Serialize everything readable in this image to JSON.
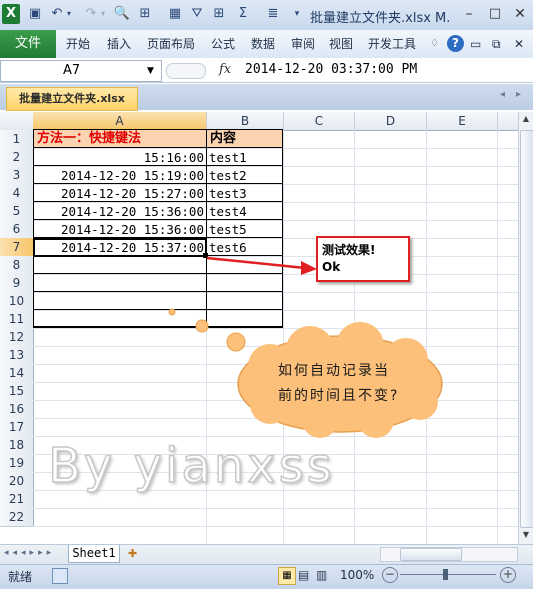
{
  "window": {
    "title": "批量建立文件夹.xlsx M."
  },
  "ribbon": {
    "file": "文件",
    "tabs": [
      "开始",
      "插入",
      "页面布局",
      "公式",
      "数据",
      "审阅",
      "视图",
      "开发工具"
    ]
  },
  "formula_bar": {
    "name_box": "A7",
    "fx": "fx",
    "value": "2014-12-20  03:37:00 PM"
  },
  "document_tab": "批量建立文件夹.xlsx",
  "columns": [
    "A",
    "B",
    "C",
    "D",
    "E"
  ],
  "rows": [
    "1",
    "2",
    "3",
    "4",
    "5",
    "6",
    "7",
    "8",
    "9",
    "10",
    "11",
    "12",
    "13",
    "14",
    "15",
    "16",
    "17",
    "18",
    "19",
    "20",
    "21",
    "22"
  ],
  "table": {
    "header_a": "方法一：快捷键法",
    "header_b": "内容",
    "a": [
      "15:16:00",
      "2014-12-20 15:19:00",
      "2014-12-20 15:27:00",
      "2014-12-20 15:36:00",
      "2014-12-20 15:36:00",
      "2014-12-20 15:37:00"
    ],
    "b": [
      "test1",
      "test2",
      "test3",
      "test4",
      "test5",
      "test6"
    ]
  },
  "callout_box": {
    "line1": "测试效果!",
    "line2": "Ok"
  },
  "thought_bubble": {
    "line1": "如何自动记录当",
    "line2": "前的时间且不变?"
  },
  "watermark_text": "By yianxss",
  "sheet_tabs": {
    "sheet1": "Sheet1"
  },
  "status": {
    "ready": "就绪",
    "zoom": "100%"
  },
  "colors": {
    "header_fill": "#fbd3b0",
    "header_red_text": "#e00000",
    "callout_border": "#e02020",
    "bubble_fill": "#fcc07a",
    "file_tab": "#2a8a3f"
  }
}
